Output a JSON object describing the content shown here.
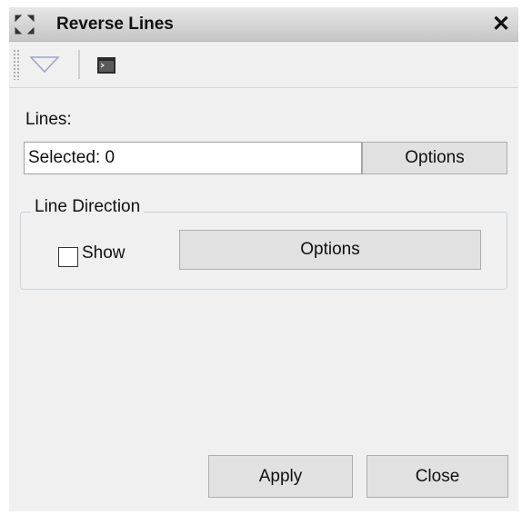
{
  "window": {
    "title": "Reverse Lines",
    "close_glyph": "✕",
    "grip_icon": "move-arrows-icon"
  },
  "toolbar": {
    "dropdown_icon": "triangle-down-icon",
    "console_icon": "console-window-icon"
  },
  "lines": {
    "label": "Lines:",
    "selected_value": "Selected: 0",
    "options_label": "Options"
  },
  "line_direction": {
    "group_title": "Line Direction",
    "show_label": "Show",
    "show_checked": false,
    "options_label": "Options"
  },
  "footer": {
    "apply_label": "Apply",
    "close_label": "Close"
  },
  "colors": {
    "panel_bg": "#f0f0f0",
    "button_bg": "#e1e1e1",
    "group_border": "#c9d3dd"
  }
}
